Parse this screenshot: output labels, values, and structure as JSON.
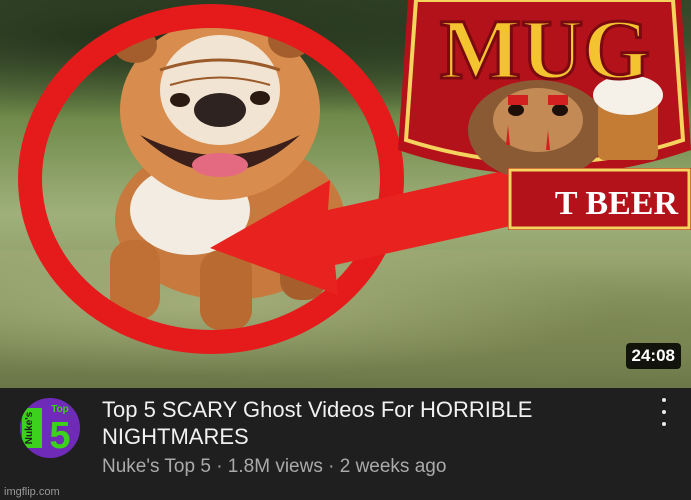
{
  "thumbnail": {
    "duration": "24:08",
    "logo_top": "MUG",
    "logo_bottom": "T BEER"
  },
  "video": {
    "title": "Top 5 SCARY Ghost Videos For HORRIBLE NIGHTMARES",
    "channel": "Nuke's Top 5",
    "views": "1.8M views",
    "age": "2 weeks ago",
    "separator": "·"
  },
  "avatar": {
    "side_text": "Nuke's",
    "top_text": "Top",
    "number": "5"
  },
  "watermark": "imgflip.com",
  "colors": {
    "circle_red": "#e51b1b",
    "arrow_red": "#e8231f",
    "logo_gold": "#f4c430",
    "logo_red": "#b3121b",
    "avatar_purple": "#6f2ab8",
    "avatar_green": "#3bd11d"
  }
}
